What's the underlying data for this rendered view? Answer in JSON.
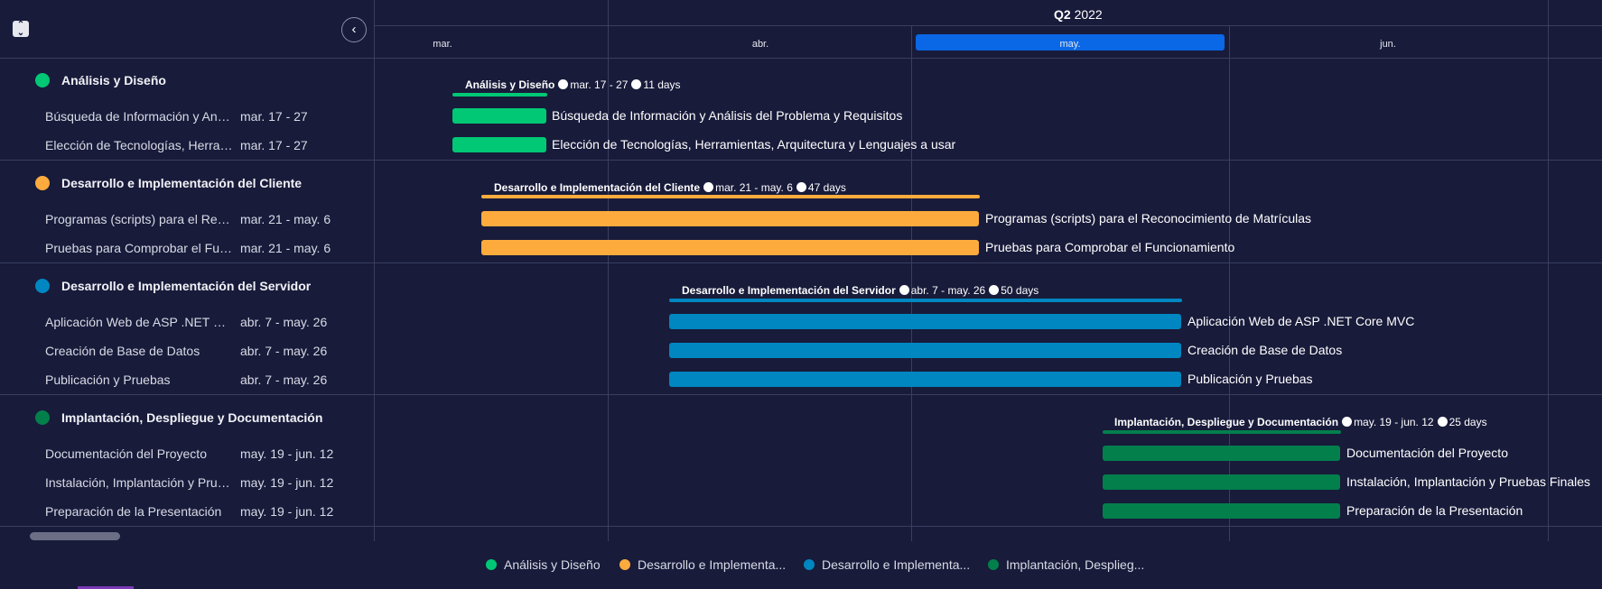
{
  "timeline": {
    "quarter_bold": "Q2",
    "quarter_year": "2022",
    "months": [
      "mar.",
      "abr.",
      "may.",
      "jun."
    ],
    "highlighted_month": "may."
  },
  "groups": [
    {
      "name": "Análisis y Diseño",
      "color": "#00c875",
      "summary": {
        "title": "Análisis y Diseño",
        "dates": "mar. 17 - 27",
        "duration": "11 days"
      },
      "tasks": [
        {
          "name": "Búsqueda de Información y Análisis del Problema y Requisitos",
          "dates": "mar. 17 - 27",
          "bar_label": "Búsqueda de Información y Análisis del Problema y Requisitos"
        },
        {
          "name": "Elección de Tecnologías, Herramientas, Arquitectura y Lenguajes a usar",
          "dates": "mar. 17 - 27",
          "bar_label": "Elección de Tecnologías, Herramientas, Arquitectura y Lenguajes a usar"
        }
      ]
    },
    {
      "name": "Desarrollo e Implementación del Cliente",
      "color": "#fdab3d",
      "summary": {
        "title": "Desarrollo e Implementación del Cliente",
        "dates": "mar. 21 - may. 6",
        "duration": "47 days"
      },
      "tasks": [
        {
          "name": "Programas (scripts) para el Reconocimiento de Matrículas",
          "dates": "mar. 21 - may. 6",
          "bar_label": "Programas (scripts) para el Reconocimiento de Matrículas"
        },
        {
          "name": "Pruebas para Comprobar el Funcionamiento",
          "dates": "mar. 21 - may. 6",
          "bar_label": "Pruebas para Comprobar el Funcionamiento"
        }
      ]
    },
    {
      "name": "Desarrollo e Implementación del Servidor",
      "color": "#0086c0",
      "summary": {
        "title": "Desarrollo e Implementación del Servidor",
        "dates": "abr. 7 - may. 26",
        "duration": "50 days"
      },
      "tasks": [
        {
          "name": "Aplicación Web de ASP .NET Core MVC",
          "dates": "abr. 7 - may. 26",
          "bar_label": "Aplicación Web de ASP .NET Core MVC"
        },
        {
          "name": "Creación de Base de Datos",
          "dates": "abr. 7 - may. 26",
          "bar_label": "Creación de Base de Datos"
        },
        {
          "name": "Publicación y Pruebas",
          "dates": "abr. 7 - may. 26",
          "bar_label": "Publicación y Pruebas"
        }
      ]
    },
    {
      "name": "Implantación, Despliegue y Documentación",
      "color": "#037f4c",
      "summary": {
        "title": "Implantación, Despliegue y Documentación",
        "dates": "may. 19 - jun. 12",
        "duration": "25 days"
      },
      "tasks": [
        {
          "name": "Documentación del Proyecto",
          "dates": "may. 19 - jun. 12",
          "bar_label": "Documentación del Proyecto"
        },
        {
          "name": "Instalación, Implantación y Pruebas Finales",
          "dates": "may. 19 - jun. 12",
          "bar_label": "Instalación, Implantación y Pruebas Finales"
        },
        {
          "name": "Preparación de la Presentación",
          "dates": "may. 19 - jun. 12",
          "bar_label": "Preparación de la Presentación"
        }
      ]
    }
  ],
  "legend": [
    {
      "label": "Análisis y Diseño",
      "color": "#00c875"
    },
    {
      "label": "Desarrollo e Implementa...",
      "color": "#fdab3d"
    },
    {
      "label": "Desarrollo e Implementa...",
      "color": "#0086c0"
    },
    {
      "label": "Implantación, Desplieg...",
      "color": "#037f4c"
    }
  ]
}
